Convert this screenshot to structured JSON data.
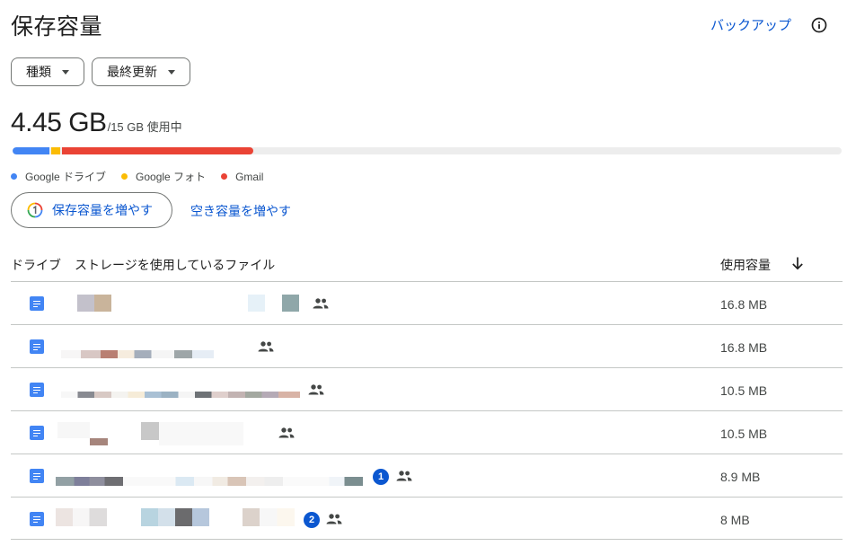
{
  "header": {
    "title": "保存容量",
    "backup_label": "バックアップ",
    "info_icon": "info-icon"
  },
  "filters": {
    "type_label": "種類",
    "modified_label": "最終更新"
  },
  "usage": {
    "used": "4.45 GB",
    "detail": "/15 GB 使用中",
    "used_fraction": 0.297,
    "segments": [
      {
        "name": "drive",
        "color": "#4285f4"
      },
      {
        "name": "photos",
        "color": "#fbbc04"
      },
      {
        "name": "gmail",
        "color": "#ea4335"
      }
    ]
  },
  "legend": {
    "drive": "Google ドライブ",
    "photos": "Google フォト",
    "gmail": "Gmail"
  },
  "actions": {
    "get_more_label": "保存容量を増やす",
    "free_up_label": "空き容量を増やす"
  },
  "table": {
    "col_drive": "ドライブ",
    "col_files": "ストレージを使用しているファイル",
    "col_size": "使用容量",
    "sort_icon": "arrow-down-icon",
    "rows": [
      {
        "size": "16.8 MB",
        "shared": true,
        "badge": ""
      },
      {
        "size": "16.8 MB",
        "shared": true,
        "badge": ""
      },
      {
        "size": "10.5 MB",
        "shared": true,
        "badge": ""
      },
      {
        "size": "10.5 MB",
        "shared": true,
        "badge": ""
      },
      {
        "size": "8.9 MB",
        "shared": true,
        "badge": "1"
      },
      {
        "size": "8 MB",
        "shared": true,
        "badge": "2"
      }
    ]
  }
}
